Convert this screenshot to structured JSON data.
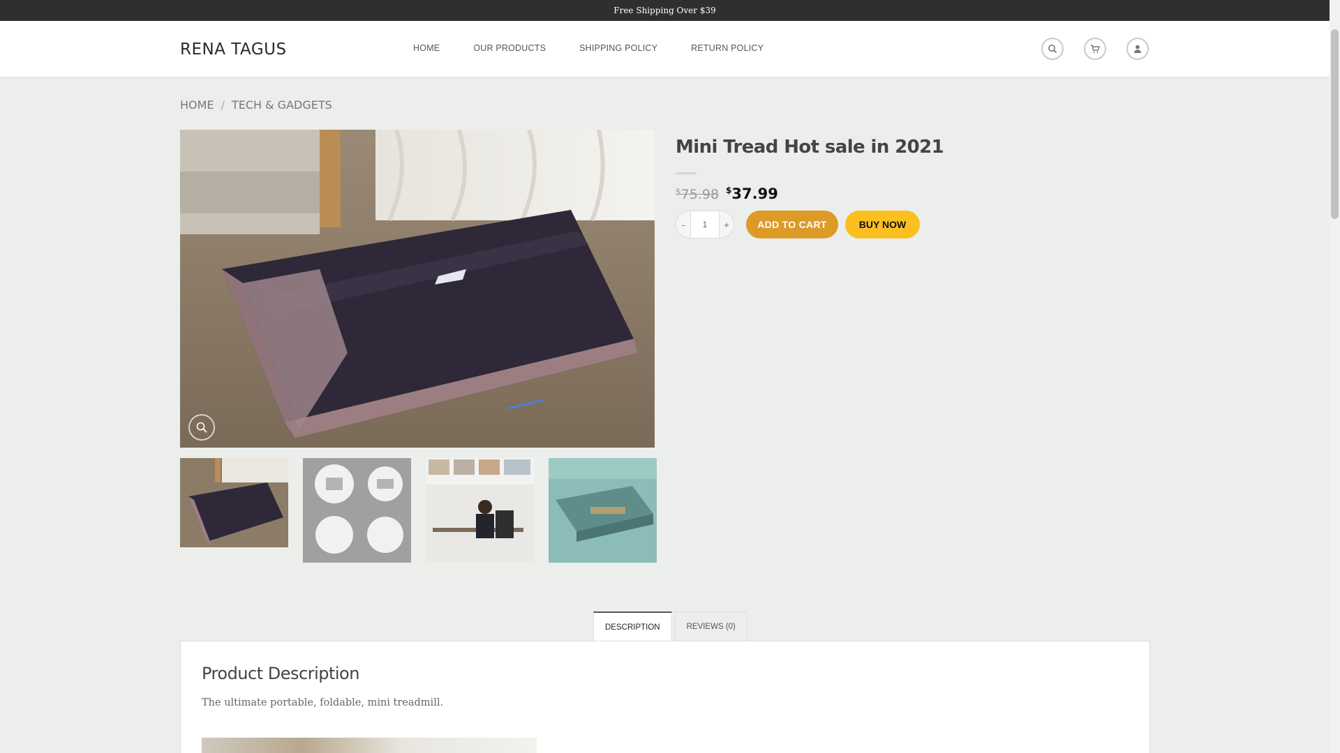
{
  "topbar": {
    "text": "Free Shipping Over $39"
  },
  "header": {
    "logo": "RENA TAGUS",
    "nav": [
      "HOME",
      "OUR PRODUCTS",
      "SHIPPING POLICY",
      "RETURN POLICY"
    ],
    "icons": [
      "search-icon",
      "cart-icon",
      "account-icon"
    ]
  },
  "breadcrumb": {
    "items": [
      "HOME",
      "TECH & GADGETS"
    ],
    "separator": "/"
  },
  "product": {
    "title": "Mini Tread Hot sale in 2021",
    "currency": "$",
    "old_price": "75.98",
    "new_price": "37.99",
    "quantity": "1",
    "minus": "-",
    "plus": "+",
    "add_to_cart": "ADD TO CART",
    "buy_now": "BUY NOW"
  },
  "tabs": [
    "DESCRIPTION",
    "REVIEWS (0)"
  ],
  "description": {
    "heading": "Product Description",
    "text": "The ultimate portable, foldable, mini treadmill."
  },
  "colors": {
    "accent": "#dd9a27",
    "buy": "#fbbf1f",
    "topbar": "#2f2f2f"
  }
}
